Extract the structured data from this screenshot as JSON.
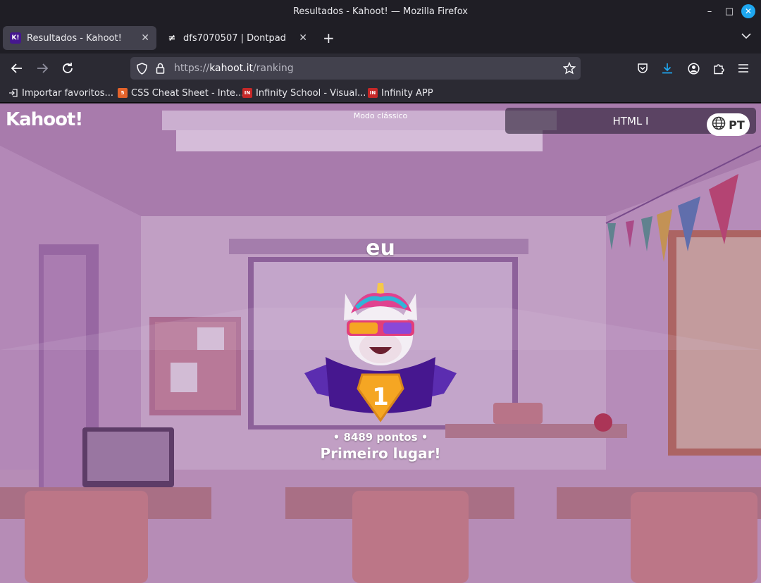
{
  "window": {
    "title": "Resultados - Kahoot! — Mozilla Firefox",
    "minimize_icon": "minimize-icon",
    "maximize_icon": "maximize-icon",
    "close_icon": "close-icon"
  },
  "tabs": [
    {
      "label": "Resultados - Kahoot!",
      "favicon": "K!",
      "active": true
    },
    {
      "label": "dfs7070507 | Dontpad",
      "favicon": "dontpad-icon",
      "active": false
    }
  ],
  "navbar": {
    "url_prefix": "https://",
    "url_host": "kahoot.it",
    "url_path": "/ranking"
  },
  "bookmarks": [
    {
      "label": "Importar favoritos...",
      "icon": "import-icon"
    },
    {
      "label": "CSS Cheat Sheet - Inte...",
      "icon": "html5-icon"
    },
    {
      "label": "Infinity School - Visual...",
      "icon": "IN"
    },
    {
      "label": "Infinity APP",
      "icon": "IN"
    }
  ],
  "page": {
    "logo": "Kahoot!",
    "mode": "Modo clássico",
    "quiz_title": "HTML I",
    "language": "PT",
    "player_name": "eu",
    "rank": "1",
    "points": "• 8489 pontos •",
    "place": "Primeiro lugar!",
    "colors": {
      "kahoot_purple": "#46178f",
      "gold": "#f5a623",
      "firefox_accent": "#1ea7f0"
    }
  }
}
